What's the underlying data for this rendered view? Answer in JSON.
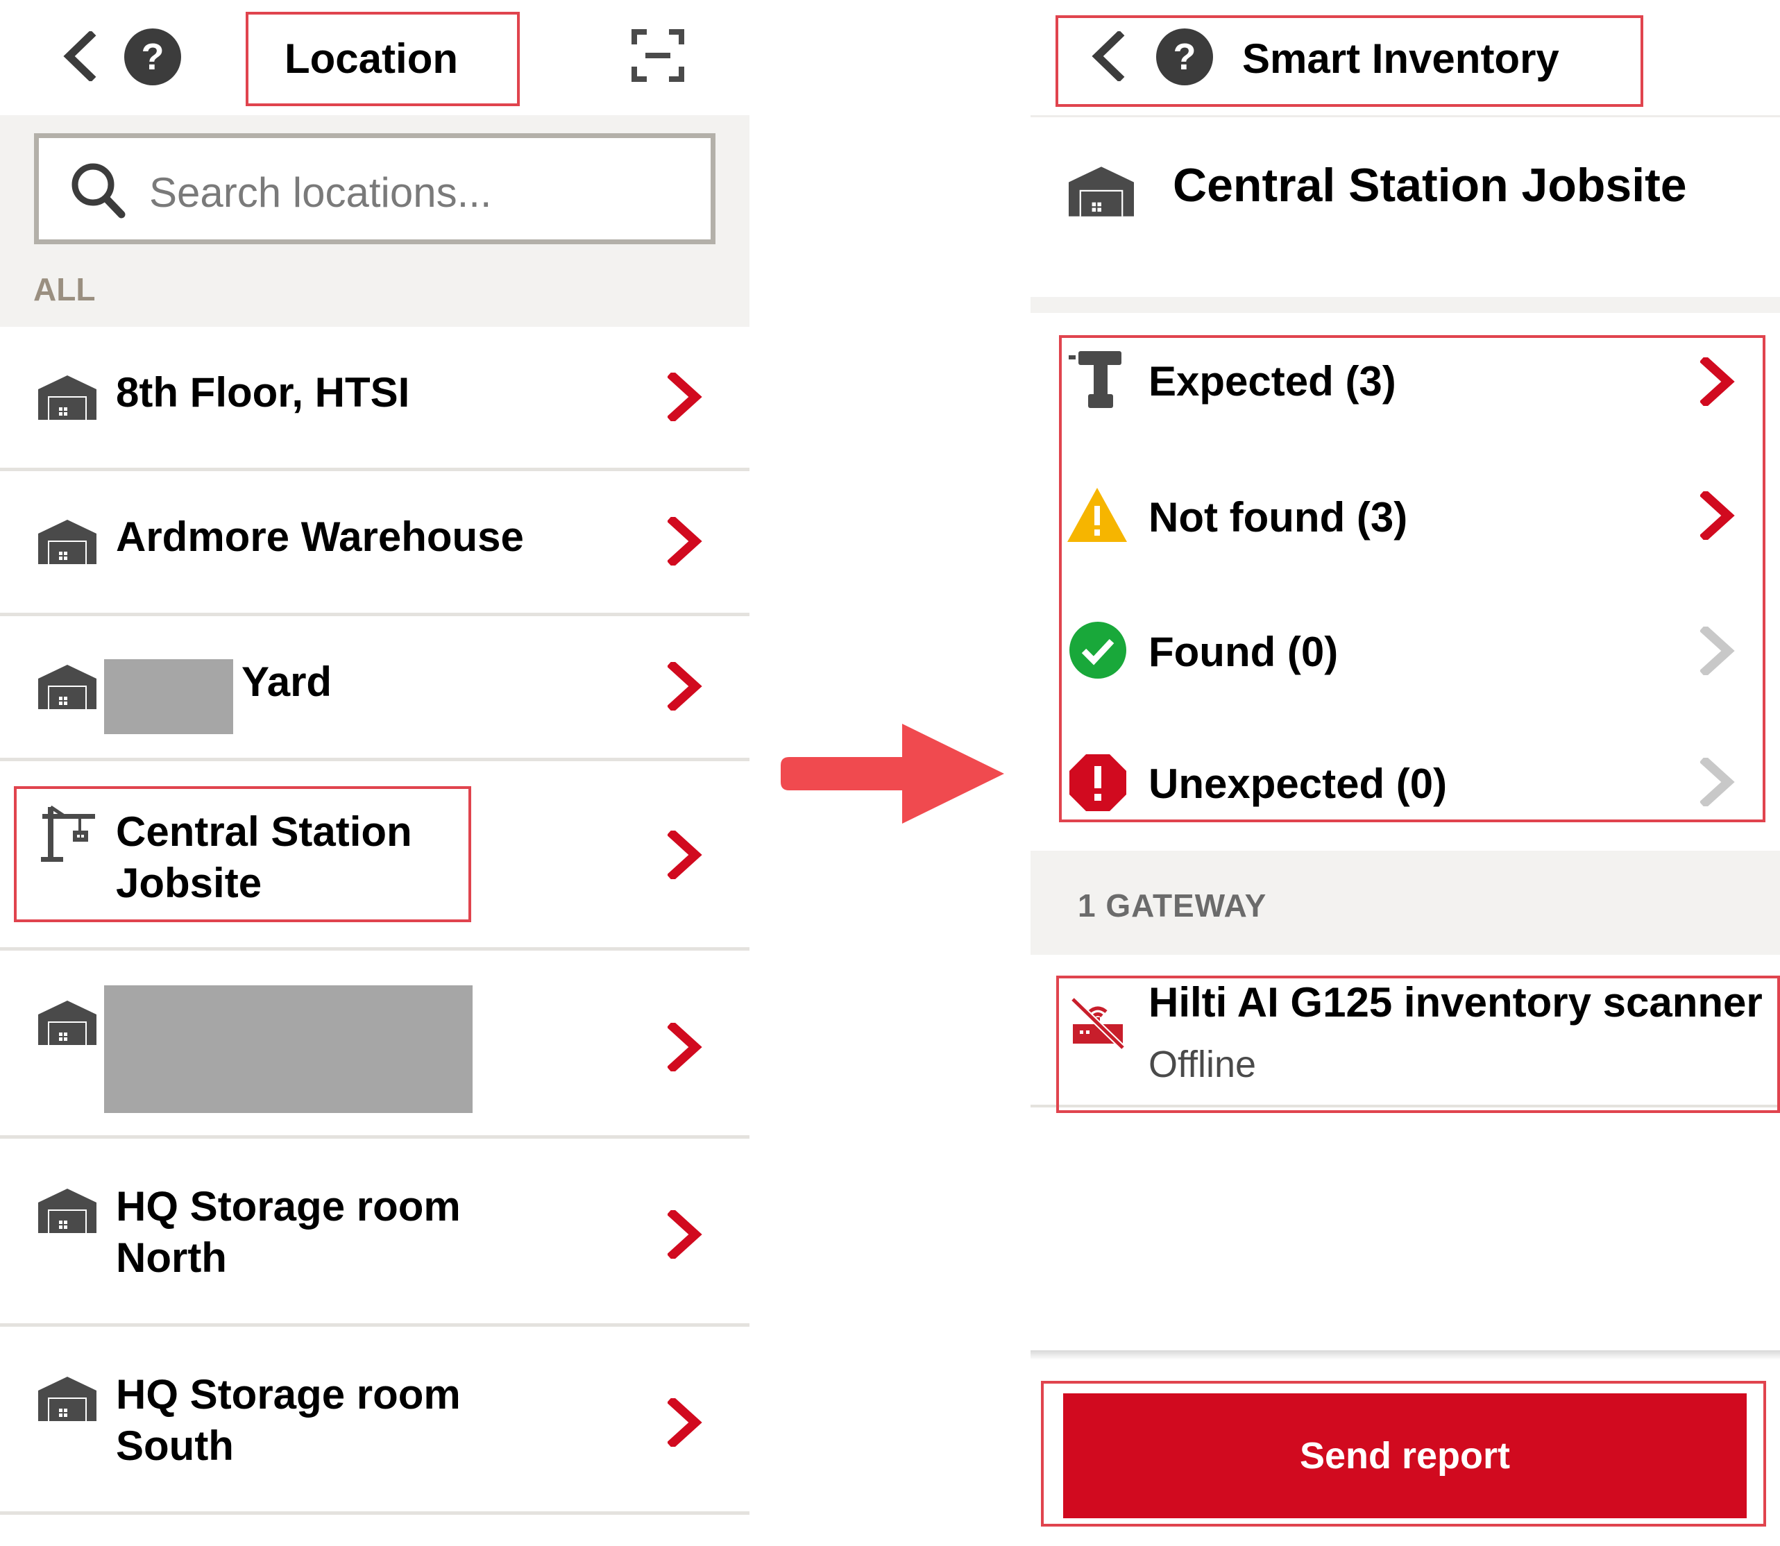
{
  "left_screen": {
    "header": {
      "title": "Location",
      "back_icon": "chevron-left-icon",
      "help_icon": "question-circle-icon",
      "scan_icon": "scan-icon"
    },
    "search": {
      "placeholder": "Search locations..."
    },
    "section_label": "ALL",
    "locations": [
      {
        "label": "8th Floor, HTSI",
        "icon": "warehouse-icon"
      },
      {
        "label": "Ardmore Warehouse",
        "icon": "warehouse-icon"
      },
      {
        "label": "Yard",
        "icon": "warehouse-icon"
      },
      {
        "label_line1": "Central Station",
        "label_line2": "Jobsite",
        "icon": "crane-icon"
      },
      {
        "label": "",
        "icon": "warehouse-icon"
      },
      {
        "label_line1": "HQ Storage room",
        "label_line2": "North",
        "icon": "warehouse-icon"
      },
      {
        "label_line1": "HQ Storage room",
        "label_line2": "South",
        "icon": "warehouse-icon"
      }
    ]
  },
  "right_screen": {
    "header": {
      "title": "Smart Inventory",
      "back_icon": "chevron-left-icon",
      "help_icon": "question-circle-icon"
    },
    "location_title": "Central Station Jobsite",
    "status_items": [
      {
        "label": "Expected (3)",
        "icon": "drill-icon",
        "enabled": true
      },
      {
        "label": "Not found (3)",
        "icon": "warning-icon",
        "enabled": true
      },
      {
        "label": "Found (0)",
        "icon": "check-circle-icon",
        "enabled": false
      },
      {
        "label": "Unexpected (0)",
        "icon": "error-octagon-icon",
        "enabled": false
      }
    ],
    "gateway_header": "1 GATEWAY",
    "gateway": {
      "name": "Hilti AI G125 inventory scanner",
      "status": "Offline",
      "icon": "gateway-offline-icon"
    },
    "send_button": "Send report"
  },
  "colors": {
    "accent": "#d10a1f",
    "highlight": "#e0444e",
    "arrow": "#f04a4f",
    "disabled": "#c8c8c8",
    "warning": "#f6b500",
    "success": "#19a83a",
    "icon_gray": "#4a4a4a"
  }
}
